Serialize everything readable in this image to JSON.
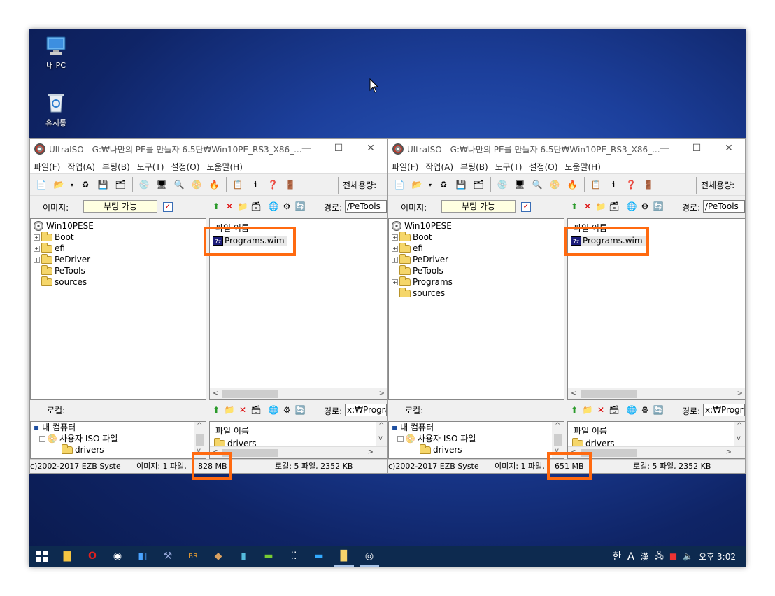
{
  "desktop": {
    "icons": [
      {
        "label": "내 PC",
        "icon": "computer-icon"
      },
      {
        "label": "휴지통",
        "icon": "recycle-bin-icon"
      }
    ]
  },
  "windows": [
    {
      "title": "UltraISO - G:₩나만의 PE를 만들자 6.5탄₩Win10PE_RS3_X86_...",
      "menu": [
        "파일(F)",
        "작업(A)",
        "부팅(B)",
        "도구(T)",
        "설정(O)",
        "도움말(H)"
      ],
      "capacity_label": "전체용량:",
      "image_label": "이미지:",
      "boot_status": "부팅 가능",
      "path_label": "경로:",
      "iso_path": "/PeTools",
      "tree": [
        {
          "label": "Win10PESE",
          "type": "disc",
          "expander": false
        },
        {
          "label": "Boot",
          "type": "folder",
          "expander": true
        },
        {
          "label": "efi",
          "type": "folder",
          "expander": true
        },
        {
          "label": "PeDriver",
          "type": "folder",
          "expander": true
        },
        {
          "label": "PeTools",
          "type": "folder",
          "expander": false
        },
        {
          "label": "sources",
          "type": "folder",
          "expander": false
        }
      ],
      "file_header": "파일 이름",
      "file_item": "Programs.wim",
      "local_label": "로컬:",
      "local_path": "x:₩Progra",
      "local_tree": [
        "내 컴퓨터",
        "사용자 ISO 파일",
        "drivers"
      ],
      "local_file_header": "파일 이름",
      "local_file_item": "drivers",
      "status": {
        "copyright": "c)2002-2017 EZB Syste",
        "image_info": "이미지: 1 파일,",
        "image_size": "828 MB",
        "local_info": "로컬: 5 파일, 2352 KB"
      }
    },
    {
      "title": "UltraISO - G:₩나만의 PE를 만들자 6.5탄₩Win10PE_RS3_X86_...",
      "menu": [
        "파일(F)",
        "작업(A)",
        "부팅(B)",
        "도구(T)",
        "설정(O)",
        "도움말(H)"
      ],
      "capacity_label": "전체용량:",
      "image_label": "이미지:",
      "boot_status": "부팅 가능",
      "path_label": "경로:",
      "iso_path": "/PeTools",
      "tree": [
        {
          "label": "Win10PESE",
          "type": "disc",
          "expander": false
        },
        {
          "label": "Boot",
          "type": "folder",
          "expander": true
        },
        {
          "label": "efi",
          "type": "folder",
          "expander": true
        },
        {
          "label": "PeDriver",
          "type": "folder",
          "expander": true
        },
        {
          "label": "PeTools",
          "type": "folder",
          "expander": false
        },
        {
          "label": "Programs",
          "type": "folder",
          "expander": true
        },
        {
          "label": "sources",
          "type": "folder",
          "expander": false
        }
      ],
      "file_header": "파일 이름",
      "file_item": "Programs.wim",
      "local_label": "로컬:",
      "local_path": "x:₩Progra",
      "local_tree": [
        "내 컴퓨터",
        "사용자 ISO 파일",
        "drivers"
      ],
      "local_file_header": "파일 이름",
      "local_file_item": "drivers",
      "status": {
        "copyright": "c)2002-2017 EZB Syste",
        "image_info": "이미지: 1 파일,",
        "image_size": "651 MB",
        "local_info": "로컬: 5 파일, 2352 KB"
      }
    }
  ],
  "taskbar": {
    "items": [
      "start-icon",
      "file-explorer-icon",
      "opera-icon",
      "chrome-icon",
      "windows-icon",
      "tool-icon",
      "br-icon",
      "acorn-icon",
      "document-icon",
      "terminal-icon",
      "task-view-icon",
      "chat-icon",
      "notepad-icon",
      "ultraiso-icon"
    ],
    "ime_han": "한",
    "ime_a": "A",
    "ime_hanja": "漢",
    "clock": "오후 3:02"
  },
  "colors": {
    "highlight": "#ff6a10",
    "boot_box": "#ffffe1",
    "taskbar": "#0d2a4f"
  }
}
